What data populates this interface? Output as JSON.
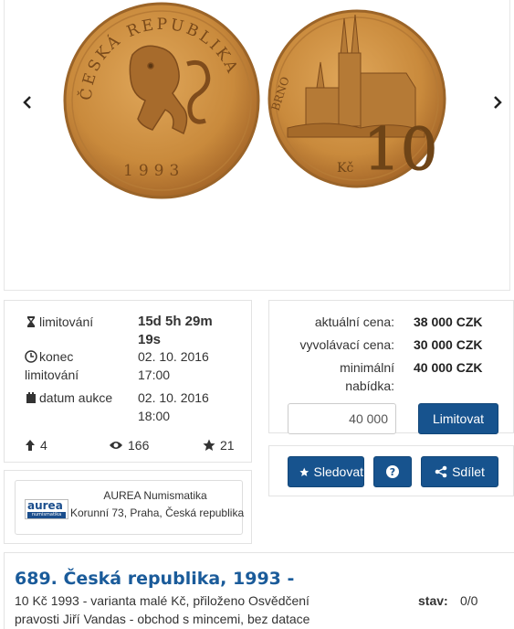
{
  "gallery": {
    "coin_left": {
      "lettering": "ČESKÁ REPUBLIKA",
      "year": "1993"
    },
    "coin_right": {
      "lettering": "BRNO",
      "denomination": "10",
      "unit": "Kč"
    }
  },
  "timing": {
    "limit_label": "limitování",
    "limit_value_1": "15d 5h 29m",
    "limit_value_2": "19s",
    "end_label_1": "konec",
    "end_label_2": "limitování",
    "end_date": "02. 10. 2016",
    "end_time": "17:00",
    "auction_label": "datum aukce",
    "auction_date": "02. 10. 2016",
    "auction_time": "18:00",
    "bids_count": "4",
    "views_count": "166",
    "watch_count": "21"
  },
  "price": {
    "current_label": "aktuální cena:",
    "current_value": "38 000 CZK",
    "start_label": "vyvolávací cena:",
    "start_value": "30 000 CZK",
    "min_label_1": "minimální",
    "min_label_2": "nabídka:",
    "min_value": "40 000 CZK",
    "bid_input_value": "40 000",
    "limit_button": "Limitovat"
  },
  "actions": {
    "follow_button": "Sledovat",
    "help_button": "?",
    "share_button": "Sdílet"
  },
  "seller": {
    "logo_text": "aurea",
    "logo_sub": "numismatika",
    "name": "AUREA Numismatika",
    "address": "Korunní 73, Praha, Česká republika"
  },
  "lot": {
    "title": "689. Česká republika, 1993 -",
    "desc_1": "10 Kč 1993 - varianta malé Kč, přiloženo Osvědčení",
    "desc_2": "pravosti Jiří Vandas - obchod s mincemi, bez datace",
    "state_label": "stav:",
    "state_value": "0/0"
  },
  "colors": {
    "accent": "#17538e",
    "link": "#1a5b9a",
    "coin": "#c98a3c"
  }
}
